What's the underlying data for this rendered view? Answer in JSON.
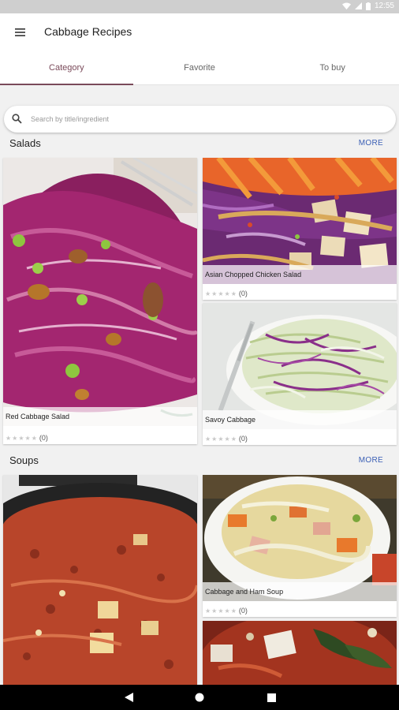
{
  "status_bar": {
    "time": "12:55",
    "icons": [
      "wifi-icon",
      "signal-icon",
      "battery-icon"
    ]
  },
  "app_bar": {
    "title": "Cabbage Recipes",
    "menu_icon": "hamburger-menu-icon"
  },
  "tabs": [
    {
      "label": "Category",
      "active": true
    },
    {
      "label": "Favorite",
      "active": false
    },
    {
      "label": "To buy",
      "active": false
    }
  ],
  "search": {
    "placeholder": "Search by title/ingredient",
    "icon": "search-icon"
  },
  "sections": [
    {
      "title": "Salads",
      "more": "MORE",
      "cards": [
        {
          "title": "Red Cabbage Salad",
          "rating_count": "(0)"
        },
        {
          "title": "Asian Chopped Chicken Salad",
          "rating_count": "(0)"
        },
        {
          "title": "Savoy Cabbage",
          "rating_count": "(0)"
        }
      ]
    },
    {
      "title": "Soups",
      "more": "MORE",
      "cards": [
        {
          "title": "",
          "rating_count": ""
        },
        {
          "title": "Cabbage and Ham Soup",
          "rating_count": "(0)"
        },
        {
          "title": "",
          "rating_count": ""
        }
      ]
    }
  ],
  "rating_stars": "★★★★★",
  "nav_bar": {
    "back_icon": "back-triangle-icon",
    "home_icon": "home-circle-icon",
    "recents_icon": "recents-square-icon"
  },
  "colors": {
    "accent": "#7a4a5a",
    "more_link": "#3b5fb5"
  }
}
